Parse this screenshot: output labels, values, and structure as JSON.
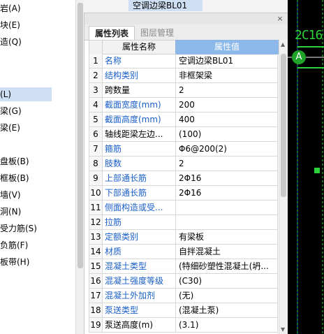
{
  "left_menu": {
    "items": [
      "岩(A)",
      "块(E)",
      "造(Q)",
      "",
      "",
      "(L)",
      "梁(G)",
      "梁(E)",
      "",
      "盘板(B)",
      "框板(B)",
      "墙(V)",
      "洞(N)",
      "受力筋(S)",
      "负筋(F)",
      "板带(H)"
    ],
    "selected_index": 5
  },
  "top_panel": {
    "selected_label": "空调边梁BL01"
  },
  "panel": {
    "close_symbol": "×",
    "tabs": [
      "属性列表",
      "图层管理"
    ],
    "active_tab": "属性列表"
  },
  "grid": {
    "header_name": "属性名称",
    "header_value": "属性值",
    "rows": [
      {
        "num": "1",
        "name": "名称",
        "value": "空调边梁BL01",
        "blue": true
      },
      {
        "num": "2",
        "name": "结构类别",
        "value": "非框架梁",
        "blue": true
      },
      {
        "num": "3",
        "name": "跨数量",
        "value": "2",
        "blue": false
      },
      {
        "num": "4",
        "name": "截面宽度(mm)",
        "value": "200",
        "blue": true
      },
      {
        "num": "5",
        "name": "截面高度(mm)",
        "value": "400",
        "blue": true
      },
      {
        "num": "6",
        "name": "轴线距梁左边...",
        "value": "(100)",
        "blue": false
      },
      {
        "num": "7",
        "name": "箍筋",
        "value": "Φ6@200(2)",
        "blue": true
      },
      {
        "num": "8",
        "name": "肢数",
        "value": "2",
        "blue": true
      },
      {
        "num": "9",
        "name": "上部通长筋",
        "value": "2Φ16",
        "blue": true
      },
      {
        "num": "10",
        "name": "下部通长筋",
        "value": "2Φ16",
        "blue": true
      },
      {
        "num": "11",
        "name": "侧面构造或受...",
        "value": "",
        "blue": true
      },
      {
        "num": "12",
        "name": "拉筋",
        "value": "",
        "blue": true
      },
      {
        "num": "13",
        "name": "定额类别",
        "value": "有梁板",
        "blue": true
      },
      {
        "num": "14",
        "name": "材质",
        "value": "自拌混凝土",
        "blue": true
      },
      {
        "num": "15",
        "name": "混凝土类型",
        "value": "(特细砂塑性混凝土(坍...",
        "blue": true
      },
      {
        "num": "16",
        "name": "混凝土强度等级",
        "value": "(C30)",
        "blue": true
      },
      {
        "num": "17",
        "name": "混凝土外加剂",
        "value": "(无)",
        "blue": true
      },
      {
        "num": "18",
        "name": "泵送类型",
        "value": "(混凝土泵)",
        "blue": true
      },
      {
        "num": "19",
        "name": "泵送高度(m)",
        "value": "(3.1)",
        "blue": false
      }
    ]
  },
  "scrollbar": {
    "up_arrow": "▲",
    "down_arrow": "▼"
  },
  "cad": {
    "label_text": "2C16",
    "circle_text": "A",
    "colors": {
      "background": "#000000",
      "line": "#2fd13a",
      "circle": "#1fa32a",
      "blue_line": "#1f4fd6"
    }
  },
  "colors": {
    "accent": "#8cb8ea",
    "selected": "#cfe0f5",
    "link_blue": "#1a5fc8"
  }
}
